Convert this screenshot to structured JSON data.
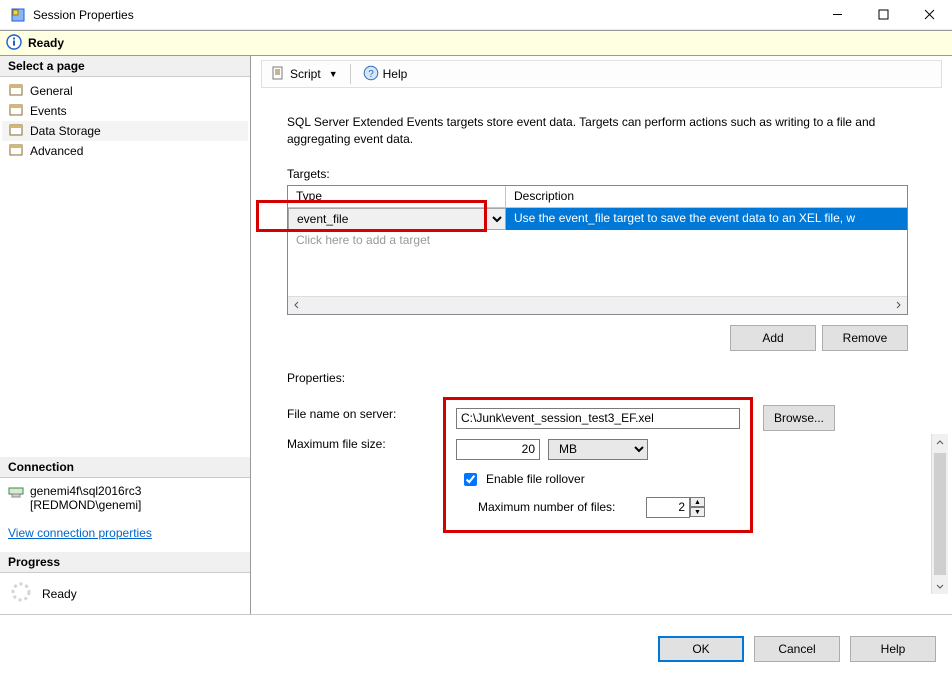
{
  "window": {
    "title": "Session Properties"
  },
  "readybar": {
    "text": "Ready"
  },
  "left": {
    "pages_header": "Select a page",
    "pages": [
      {
        "label": "General"
      },
      {
        "label": "Events"
      },
      {
        "label": "Data Storage"
      },
      {
        "label": "Advanced"
      }
    ],
    "selected_index": 2,
    "connection": {
      "header": "Connection",
      "server": "genemi4f\\sql2016rc3",
      "user": "[REDMOND\\genemi]",
      "link": "View connection properties"
    },
    "progress": {
      "header": "Progress",
      "status": "Ready"
    }
  },
  "toolbar": {
    "script": "Script",
    "help": "Help"
  },
  "main": {
    "intro": "SQL Server Extended Events targets store event data. Targets can perform actions such as writing to a file and aggregating event data.",
    "targets_label": "Targets:",
    "table": {
      "col_type": "Type",
      "col_desc": "Description",
      "row_type_value": "event_file",
      "row_desc_value": "Use the event_file target to save the event data to an XEL file, w",
      "placeholder": "Click here to add a target"
    },
    "add": "Add",
    "remove": "Remove",
    "properties_label": "Properties:",
    "labels": {
      "filename": "File name on server:",
      "maxsize": "Maximum file size:",
      "maxfiles": "Maximum number of files:"
    },
    "fields": {
      "filename": "C:\\Junk\\event_session_test3_EF.xel",
      "maxsize": "20",
      "unit": "MB",
      "rollover": "Enable file rollover",
      "maxfiles": "2"
    },
    "browse": "Browse..."
  },
  "footer": {
    "ok": "OK",
    "cancel": "Cancel",
    "help": "Help"
  }
}
